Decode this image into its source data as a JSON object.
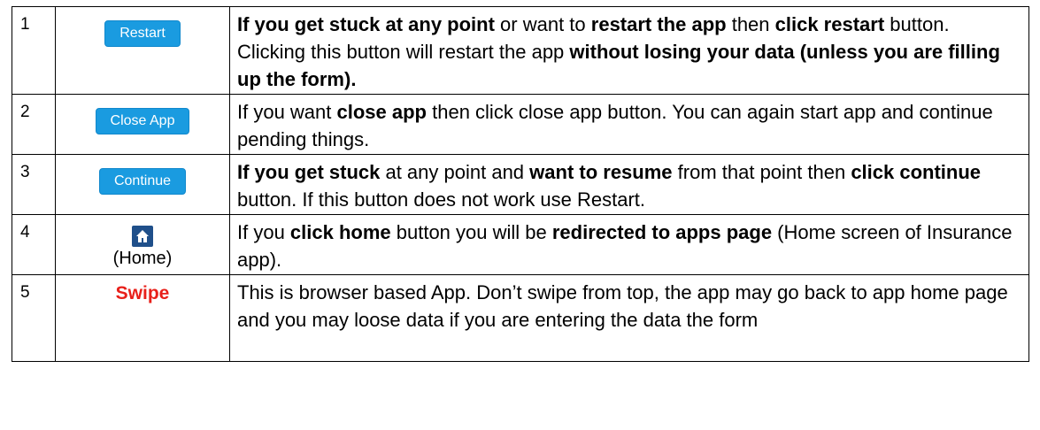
{
  "rows": [
    {
      "num": "1",
      "button_label": "Restart",
      "desc": [
        {
          "t": "If you get stuck at any point",
          "b": true
        },
        {
          "t": " or want to ",
          "b": false
        },
        {
          "t": "restart the app",
          "b": true
        },
        {
          "t": " then ",
          "b": false
        },
        {
          "t": "click restart",
          "b": true
        },
        {
          "t": " button. Clicking this button will restart the app ",
          "b": false
        },
        {
          "t": "without losing your data (unless you are filling up the form).",
          "b": true
        }
      ]
    },
    {
      "num": "2",
      "button_label": "Close App",
      "desc": [
        {
          "t": "If you want ",
          "b": false
        },
        {
          "t": "close app",
          "b": true
        },
        {
          "t": " then click close app button. You can again start app and continue pending things.",
          "b": false
        }
      ]
    },
    {
      "num": "3",
      "button_label": "Continue",
      "desc": [
        {
          "t": "If you get stuck",
          "b": true
        },
        {
          "t": " at any point and ",
          "b": false
        },
        {
          "t": "want to resume",
          "b": true
        },
        {
          "t": " from that point then ",
          "b": false
        },
        {
          "t": "click continue",
          "b": true
        },
        {
          "t": " button. If this button does not work use Restart.",
          "b": false
        }
      ]
    },
    {
      "num": "4",
      "icon_name": "home-icon",
      "icon_caption": "(Home)",
      "desc": [
        {
          "t": "If you ",
          "b": false
        },
        {
          "t": "click home",
          "b": true
        },
        {
          "t": " button you will be ",
          "b": false
        },
        {
          "t": "redirected to apps page",
          "b": true
        },
        {
          "t": " (Home screen of Insurance app).",
          "b": false
        }
      ]
    },
    {
      "num": "5",
      "swipe_label": "Swipe",
      "desc": [
        {
          "t": "This is browser based App. Don’t swipe from top, the app may go back to app home page and you may loose data if you are entering the data the form",
          "b": false
        }
      ]
    }
  ],
  "colors": {
    "button_blue": "#1a9be0",
    "home_icon_bg": "#1f4f8a",
    "swipe_red": "#e8201a",
    "border": "#000000"
  }
}
